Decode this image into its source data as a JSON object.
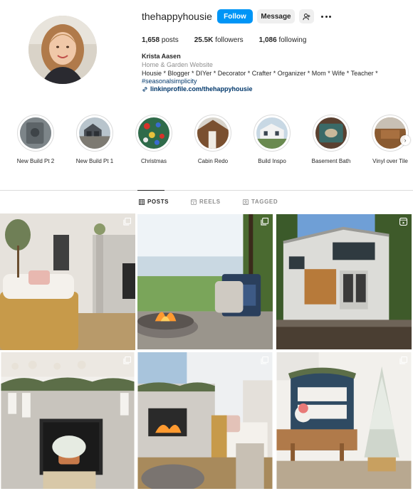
{
  "profile": {
    "username": "thehappyhousie",
    "follow_label": "Follow",
    "message_label": "Message",
    "posts_count": "1,658",
    "posts_label": "posts",
    "followers_count": "25.5K",
    "followers_label": "followers",
    "following_count": "1,086",
    "following_label": "following",
    "full_name": "Krista Aasen",
    "category": "Home & Garden Website",
    "bio": "Housie * Blogger * DIYer * Decorator * Crafter * Organizer * Mom * Wife * Teacher *",
    "hashtag": "#seasonalsimplicity",
    "link": "linkinprofile.com/thehappyhousie"
  },
  "highlights": [
    {
      "label": "New Build Pt 2"
    },
    {
      "label": "New Build Pt 1"
    },
    {
      "label": "Christmas"
    },
    {
      "label": "Cabin Redo"
    },
    {
      "label": "Build Inspo"
    },
    {
      "label": "Basement Bath"
    },
    {
      "label": "Vinyl over Tile"
    }
  ],
  "tabs": [
    {
      "label": "POSTS",
      "icon": "grid-icon",
      "active": true
    },
    {
      "label": "REELS",
      "icon": "reels-icon",
      "active": false
    },
    {
      "label": "TAGGED",
      "icon": "tagged-icon",
      "active": false
    }
  ],
  "posts": [
    {
      "type": "carousel",
      "icon": "carousel-icon"
    },
    {
      "type": "carousel",
      "icon": "carousel-icon"
    },
    {
      "type": "reel",
      "icon": "reel-icon"
    },
    {
      "type": "carousel",
      "icon": "carousel-icon"
    },
    {
      "type": "carousel",
      "icon": "carousel-icon"
    },
    {
      "type": "carousel",
      "icon": "carousel-icon"
    }
  ],
  "colors": {
    "accent": "#0095f6",
    "link": "#00376b",
    "muted": "#8e8e8e",
    "border": "#dbdbdb"
  }
}
